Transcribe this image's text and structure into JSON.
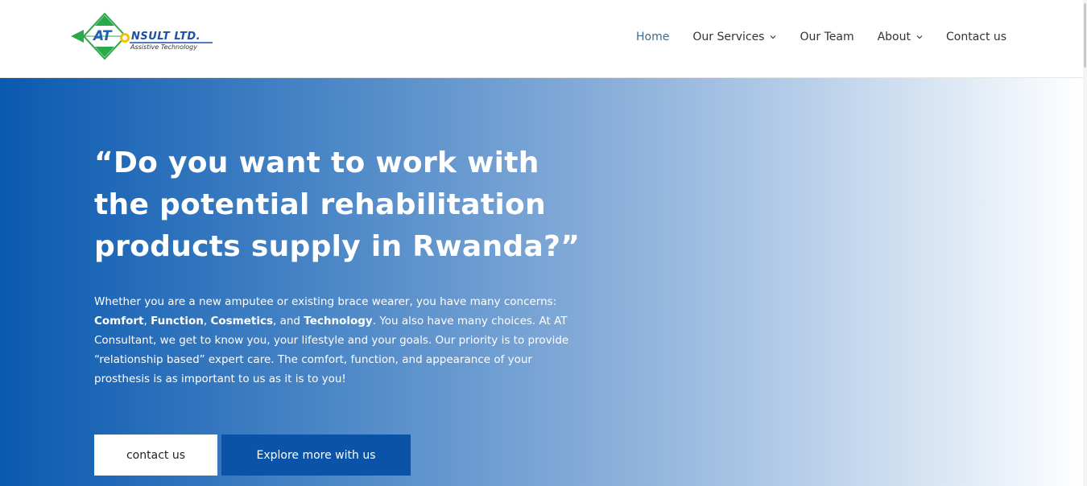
{
  "logo": {
    "at_text": "AT",
    "name_text": "NSULT LTD.",
    "tagline": "Assistive Technology",
    "colors": {
      "green": "#2aa84a",
      "blue": "#1f5fb4",
      "yellow": "#f2c200"
    }
  },
  "nav": {
    "items": [
      {
        "label": "Home",
        "active": true,
        "has_dropdown": false
      },
      {
        "label": "Our Services",
        "active": false,
        "has_dropdown": true
      },
      {
        "label": "Our Team",
        "active": false,
        "has_dropdown": false
      },
      {
        "label": "About",
        "active": false,
        "has_dropdown": true
      },
      {
        "label": "Contact us",
        "active": false,
        "has_dropdown": false
      }
    ],
    "active_color": "#3d6a8a"
  },
  "hero": {
    "title_lines": [
      "“Do you want to work with",
      "the potential rehabilitation",
      "products supply in Rwanda?”"
    ],
    "para": {
      "line1": "Whether you are a new amputee or existing brace wearer, you have many concerns:",
      "bold1": "Comfort",
      "sep1": ", ",
      "bold2": "Function",
      "sep2": ", ",
      "bold3": "Cosmetics",
      "sep3": ", and ",
      "bold4": "Technology",
      "rest": ". You also have many choices.  At AT Consultant, we get to know you, your lifestyle and your goals. Our priority is to provide “relationship based” expert care. The comfort, function, and appearance of your prosthesis is as important to us as it is to you!"
    },
    "buttons": {
      "contact_label": "contact us",
      "explore_label": "Explore more with us"
    },
    "colors": {
      "gradient_start": "#0a59b0",
      "gradient_end": "#ffffff",
      "explore_button": "#0a53a8"
    }
  }
}
